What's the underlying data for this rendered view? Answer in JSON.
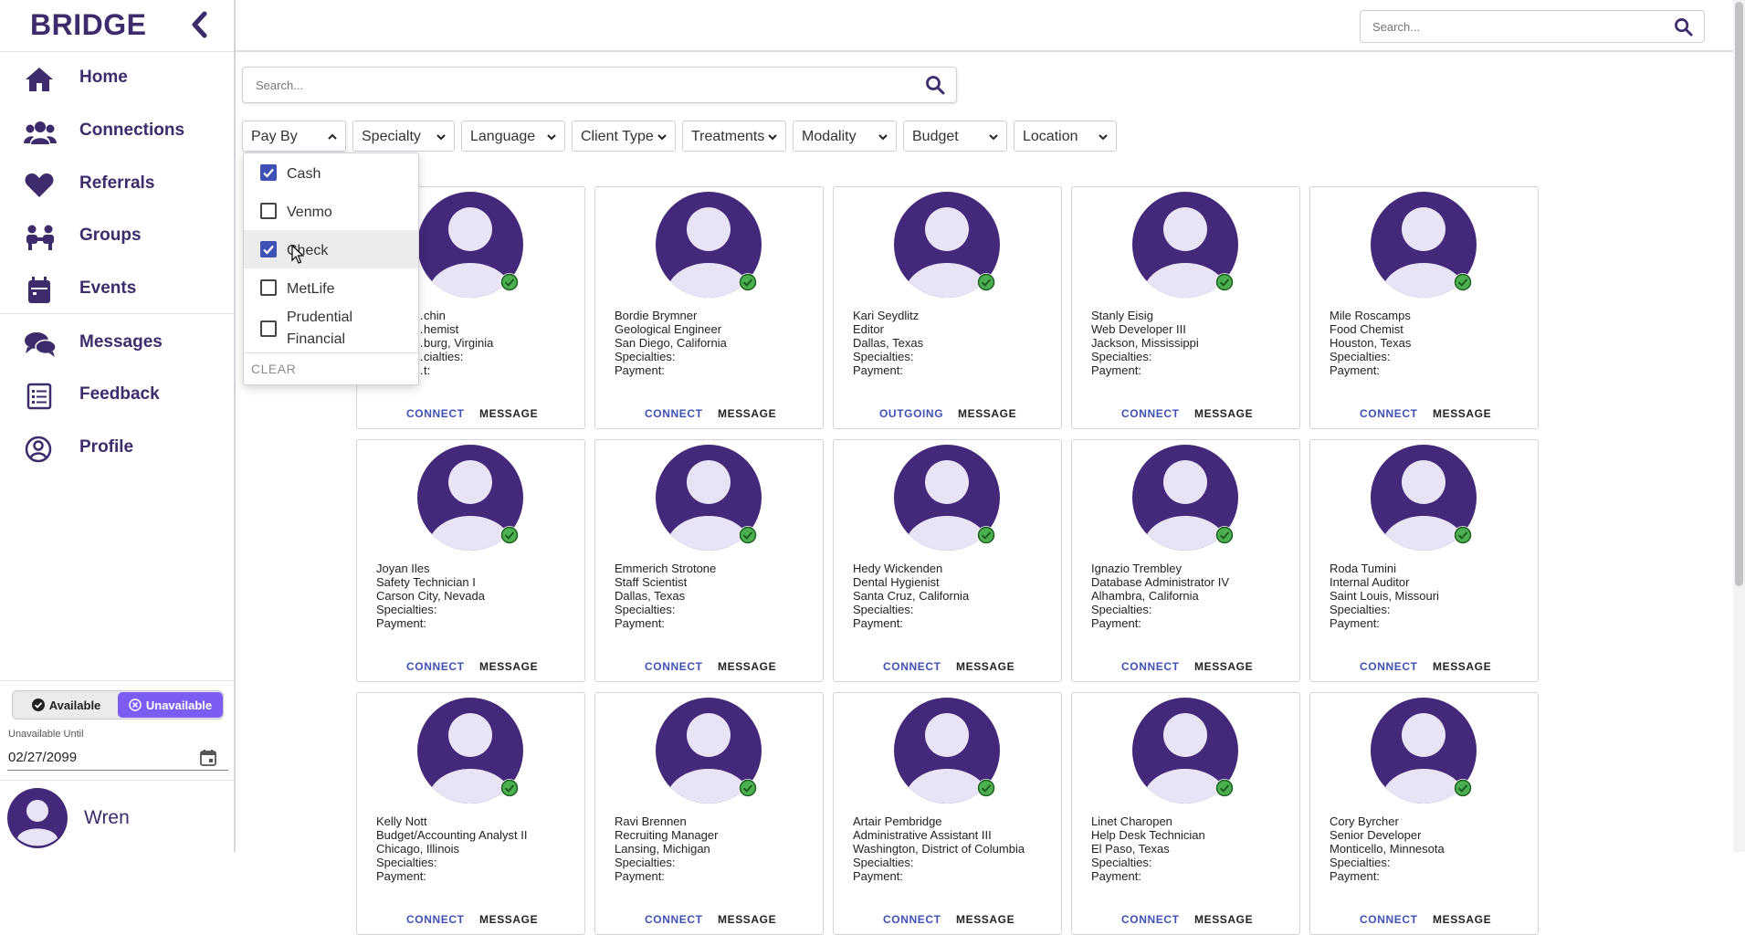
{
  "brand": {
    "name": "BRIDGE"
  },
  "sidebar": {
    "items": [
      {
        "label": "Home",
        "icon": "home-icon"
      },
      {
        "label": "Connections",
        "icon": "users-icon"
      },
      {
        "label": "Referrals",
        "icon": "heart-icon"
      },
      {
        "label": "Groups",
        "icon": "group-icon"
      },
      {
        "label": "Events",
        "icon": "calendar-icon"
      },
      {
        "label": "Messages",
        "icon": "chat-icon"
      },
      {
        "label": "Feedback",
        "icon": "feedback-icon"
      },
      {
        "label": "Profile",
        "icon": "profile-icon"
      }
    ]
  },
  "availability": {
    "available_label": "Available",
    "unavailable_label": "Unavailable",
    "selected": "Unavailable",
    "until_label": "Unavailable Until",
    "until_value": "02/27/2099"
  },
  "user": {
    "name": "Wren"
  },
  "topbar": {
    "search_placeholder": "Search..."
  },
  "search": {
    "placeholder": "Search..."
  },
  "filters": [
    "Pay By",
    "Specialty",
    "Language",
    "Client Type",
    "Treatments",
    "Modality",
    "Budget",
    "Location"
  ],
  "pay_by_dropdown": {
    "options": [
      {
        "label": "Cash",
        "checked": true
      },
      {
        "label": "Venmo",
        "checked": false
      },
      {
        "label": "Check",
        "checked": true
      },
      {
        "label": "MetLife",
        "checked": false
      },
      {
        "label": "Prudential Financial",
        "checked": false
      }
    ],
    "clear_label": "CLEAR"
  },
  "cards": [
    {
      "name": "…chin",
      "title": "…hemist",
      "location": "…burg, Virginia",
      "specialties": "…cialties:",
      "payment": "…t:",
      "action": "CONNECT",
      "message": "MESSAGE"
    },
    {
      "name": "Bordie Brymner",
      "title": "Geological Engineer",
      "location": "San Diego, California",
      "specialties": "Specialties:",
      "payment": "Payment:",
      "action": "CONNECT",
      "message": "MESSAGE"
    },
    {
      "name": "Kari Seydlitz",
      "title": "Editor",
      "location": "Dallas, Texas",
      "specialties": "Specialties:",
      "payment": "Payment:",
      "action": "OUTGOING",
      "message": "MESSAGE"
    },
    {
      "name": "Stanly Eisig",
      "title": "Web Developer III",
      "location": "Jackson, Mississippi",
      "specialties": "Specialties:",
      "payment": "Payment:",
      "action": "CONNECT",
      "message": "MESSAGE"
    },
    {
      "name": "Mile Roscamps",
      "title": "Food Chemist",
      "location": "Houston, Texas",
      "specialties": "Specialties:",
      "payment": "Payment:",
      "action": "CONNECT",
      "message": "MESSAGE"
    },
    {
      "name": "Joyan Iles",
      "title": "Safety Technician I",
      "location": "Carson City, Nevada",
      "specialties": "Specialties:",
      "payment": "Payment:",
      "action": "CONNECT",
      "message": "MESSAGE"
    },
    {
      "name": "Emmerich Strotone",
      "title": "Staff Scientist",
      "location": "Dallas, Texas",
      "specialties": "Specialties:",
      "payment": "Payment:",
      "action": "CONNECT",
      "message": "MESSAGE"
    },
    {
      "name": "Hedy Wickenden",
      "title": "Dental Hygienist",
      "location": "Santa Cruz, California",
      "specialties": "Specialties:",
      "payment": "Payment:",
      "action": "CONNECT",
      "message": "MESSAGE"
    },
    {
      "name": "Ignazio Trembley",
      "title": "Database Administrator IV",
      "location": "Alhambra, California",
      "specialties": "Specialties:",
      "payment": "Payment:",
      "action": "CONNECT",
      "message": "MESSAGE"
    },
    {
      "name": "Roda Tumini",
      "title": "Internal Auditor",
      "location": "Saint Louis, Missouri",
      "specialties": "Specialties:",
      "payment": "Payment:",
      "action": "CONNECT",
      "message": "MESSAGE"
    },
    {
      "name": "Kelly Nott",
      "title": "Budget/Accounting Analyst II",
      "location": "Chicago, Illinois",
      "specialties": "Specialties:",
      "payment": "Payment:",
      "action": "CONNECT",
      "message": "MESSAGE"
    },
    {
      "name": "Ravi Brennen",
      "title": "Recruiting Manager",
      "location": "Lansing, Michigan",
      "specialties": "Specialties:",
      "payment": "Payment:",
      "action": "CONNECT",
      "message": "MESSAGE"
    },
    {
      "name": "Artair Pembridge",
      "title": "Administrative Assistant III",
      "location": "Washington, District of Columbia",
      "specialties": "Specialties:",
      "payment": "Payment:",
      "action": "CONNECT",
      "message": "MESSAGE"
    },
    {
      "name": "Linet Charopen",
      "title": "Help Desk Technician",
      "location": "El Paso, Texas",
      "specialties": "Specialties:",
      "payment": "Payment:",
      "action": "CONNECT",
      "message": "MESSAGE"
    },
    {
      "name": "Cory Byrcher",
      "title": "Senior Developer",
      "location": "Monticello, Minnesota",
      "specialties": "Specialties:",
      "payment": "Payment:",
      "action": "CONNECT",
      "message": "MESSAGE"
    }
  ],
  "colors": {
    "brand": "#3d2b6b",
    "avatar": "#44287a",
    "avatar_light": "#e8e4f6",
    "accent": "#3f51b5",
    "online": "#4caf50",
    "unavailable": "#7c5cf2"
  }
}
